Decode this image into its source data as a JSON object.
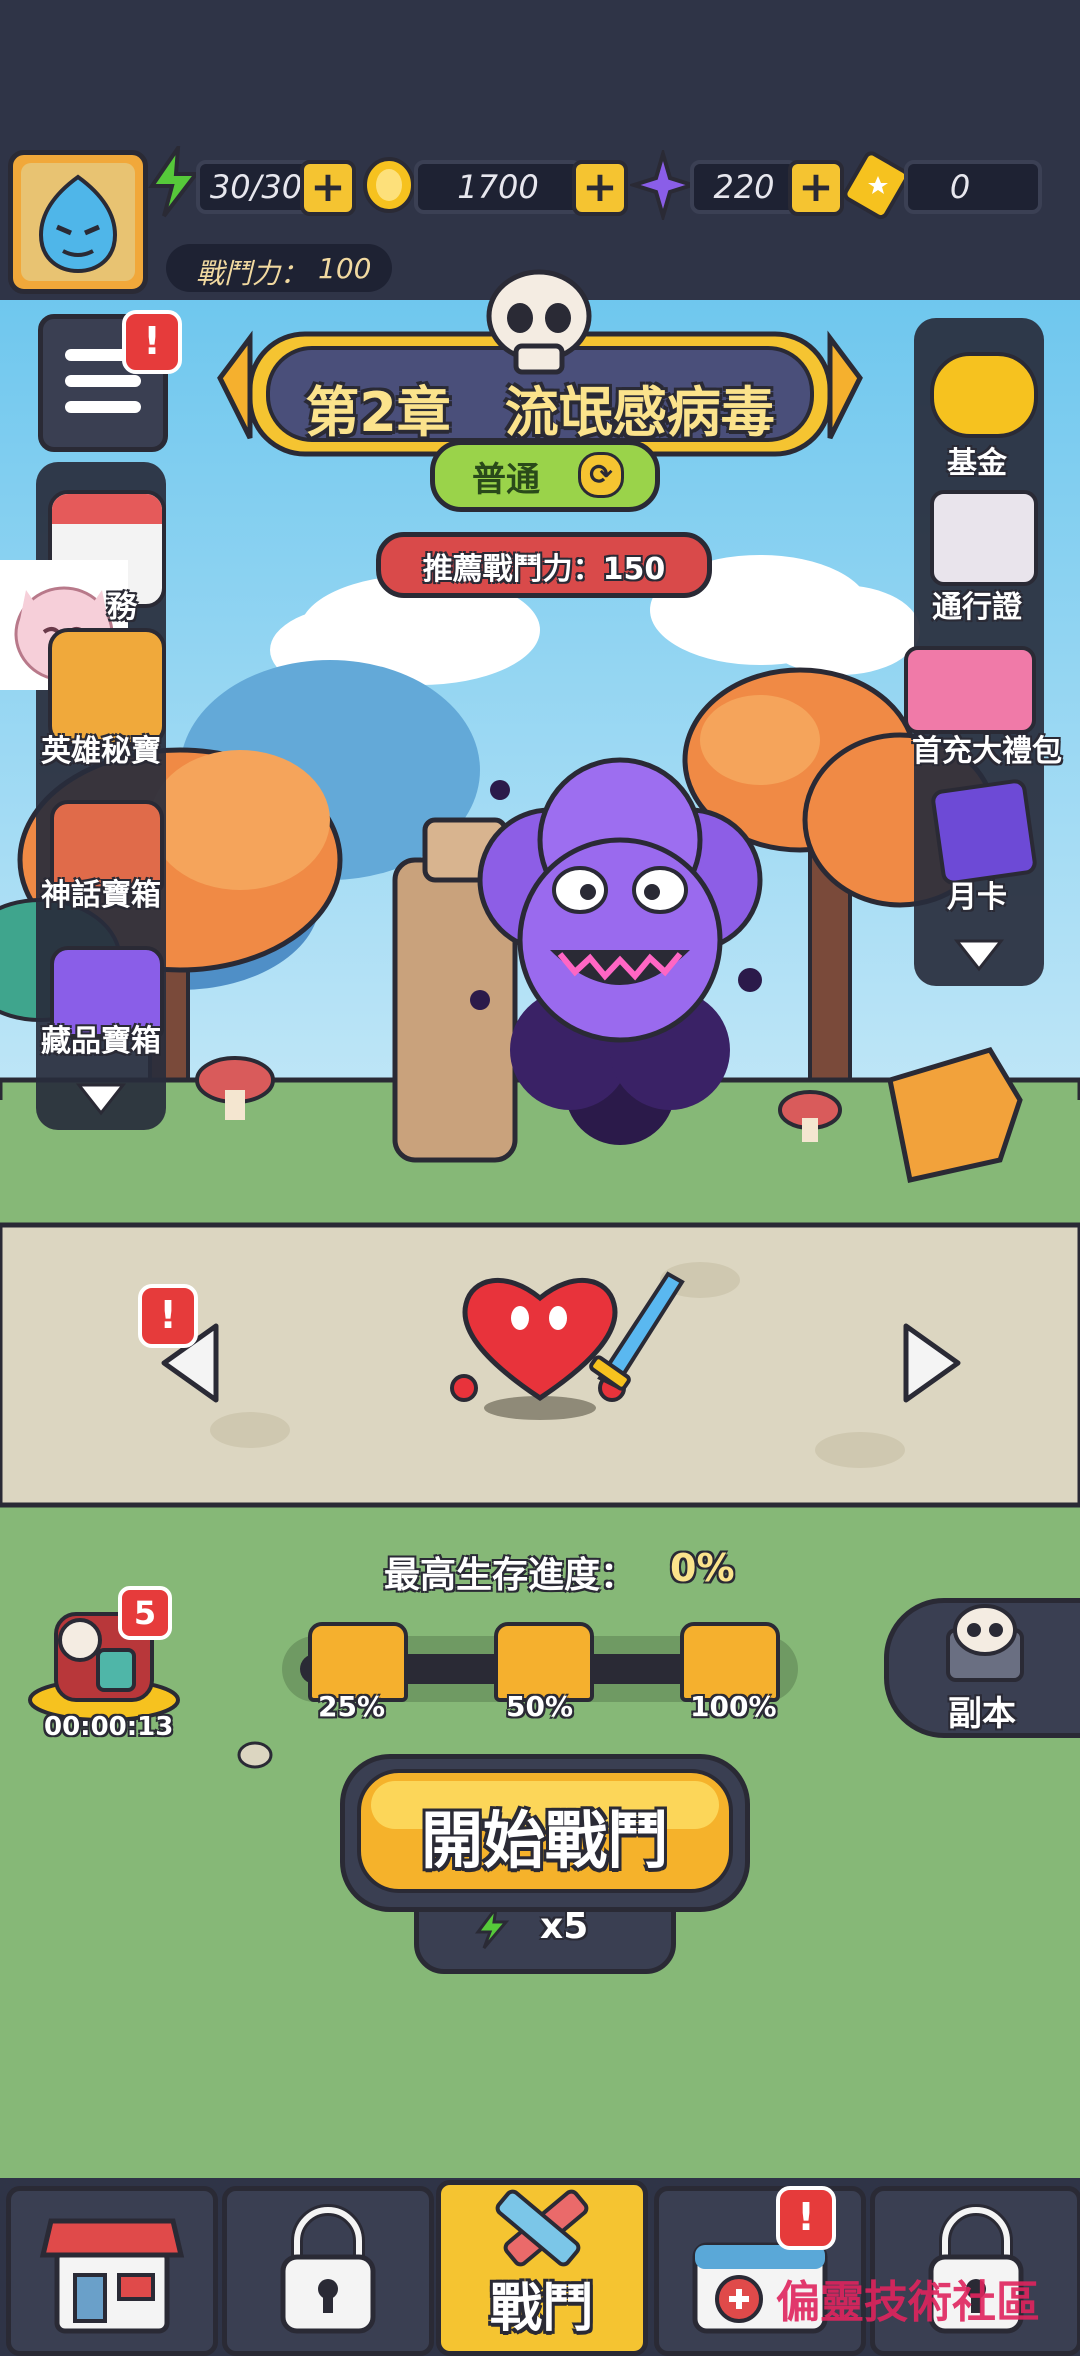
{
  "resources": {
    "energy": "30/30",
    "gold": "1700",
    "gems": "220",
    "tickets": "0"
  },
  "power": {
    "label": "戰鬥力：",
    "value": "100"
  },
  "chapter": {
    "title": "第2章　流氓感病毒",
    "difficulty": "普通",
    "recommended": "推薦戰鬥力：150"
  },
  "left_menu": [
    {
      "label": "務",
      "icon": "calendar-icon"
    },
    {
      "label": "英雄秘寶",
      "icon": "hero-treasure-icon"
    },
    {
      "label": "神話寶箱",
      "icon": "myth-chest-icon"
    },
    {
      "label": "藏品寶箱",
      "icon": "collection-chest-icon"
    }
  ],
  "right_menu": [
    {
      "label": "基金",
      "icon": "piggy-bank-icon"
    },
    {
      "label": "通行證",
      "icon": "pass-icon"
    },
    {
      "label": "首充大禮包",
      "icon": "gift-pack-icon"
    },
    {
      "label": "月卡",
      "icon": "month-card-icon"
    }
  ],
  "progress": {
    "label": "最高生存進度：",
    "value": "0%",
    "fraction": 0,
    "milestones": [
      "25%",
      "50%",
      "100%"
    ]
  },
  "reward": {
    "count": "5",
    "timer": "00:00:13"
  },
  "dungeon": {
    "label": "副本"
  },
  "start": {
    "label": "開始戰鬥",
    "cost": "x5"
  },
  "bottom_nav": [
    {
      "label": "",
      "icon": "shop-icon"
    },
    {
      "label": "",
      "icon": "lock-icon"
    },
    {
      "label": "戰鬥",
      "icon": "battle-syringe-icon"
    },
    {
      "label": "",
      "icon": "medkit-icon"
    },
    {
      "label": "",
      "icon": "lock-icon"
    }
  ],
  "watermark": "偏靈技術社區",
  "colors": {
    "accent": "#f5c431",
    "alert": "#e63b3b",
    "panel": "#3a3f52",
    "grass": "#86b877",
    "path": "#dcd6c1"
  }
}
